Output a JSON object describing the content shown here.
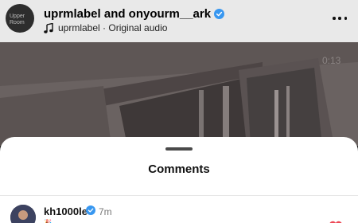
{
  "header": {
    "avatar_text": "Upper Room",
    "title": "uprmlabel and onyourm__ark",
    "audio": "uprmlabel · Original audio"
  },
  "video": {
    "timestamp": "0:13"
  },
  "comments_sheet": {
    "title": "Comments",
    "comments": [
      {
        "username": "kh1000le",
        "time": "7m",
        "text": "🎉"
      }
    ]
  },
  "colors": {
    "verified": "#3897f0",
    "heart": "#ed4956"
  }
}
